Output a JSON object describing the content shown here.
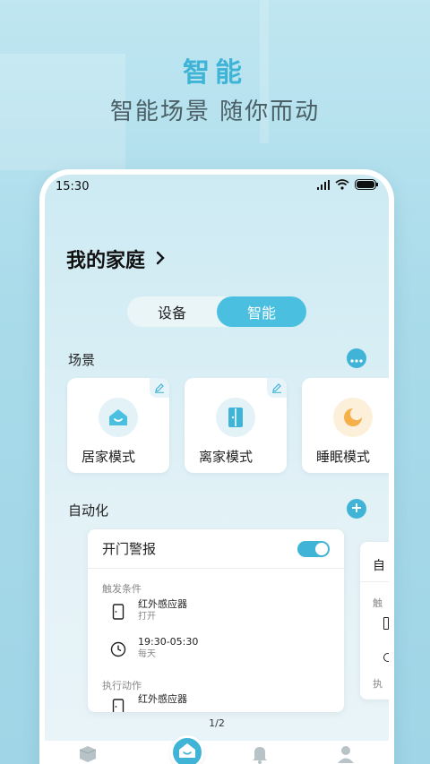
{
  "promo": {
    "title": "智能",
    "subtitle": "智能场景  随你而动"
  },
  "status_bar": {
    "time": "15:30",
    "icons": [
      "signal-icon",
      "wifi-icon",
      "battery-icon"
    ]
  },
  "home": {
    "title": "我的家庭",
    "chevron": "›"
  },
  "segmented": {
    "items": [
      "设备",
      "智能"
    ],
    "active": "智能"
  },
  "scenes": {
    "label": "场景",
    "more_icon": "more-icon",
    "items": [
      {
        "label": "居家模式",
        "icon": "home-smile-icon",
        "icon_bg": "#e3f2f7",
        "icon_color": "#4bbfe0"
      },
      {
        "label": "离家模式",
        "icon": "door-icon",
        "icon_bg": "#e3f2f7",
        "icon_color": "#3fb4d6"
      },
      {
        "label": "睡眠模式",
        "icon": "moon-icon",
        "icon_bg": "#fdf0da",
        "icon_color": "#f5b04a"
      }
    ]
  },
  "automation": {
    "label": "自动化",
    "add_icon": "plus-icon",
    "cards": [
      {
        "title": "开门警报",
        "enabled": true,
        "trigger_label": "触发条件",
        "triggers": [
          {
            "icon": "door-sensor-icon",
            "name": "红外感应器",
            "detail": "打开"
          },
          {
            "icon": "clock-icon",
            "name": "19:30-05:30",
            "detail": "每天"
          }
        ],
        "action_label": "执行动作",
        "actions": [
          {
            "icon": "door-sensor-icon",
            "name": "红外感应器"
          }
        ]
      },
      {
        "title_partial": "自",
        "trigger_partial": "触",
        "action_partial": "执"
      }
    ],
    "pager": "1/2"
  },
  "tabbar": {
    "items": [
      "devices-tab-icon",
      "home-tab-icon",
      "bell-tab-icon",
      "profile-tab-icon"
    ],
    "active": "home-tab-icon"
  },
  "colors": {
    "accent": "#3fb4d6",
    "accent_light": "#4bbfe0"
  }
}
